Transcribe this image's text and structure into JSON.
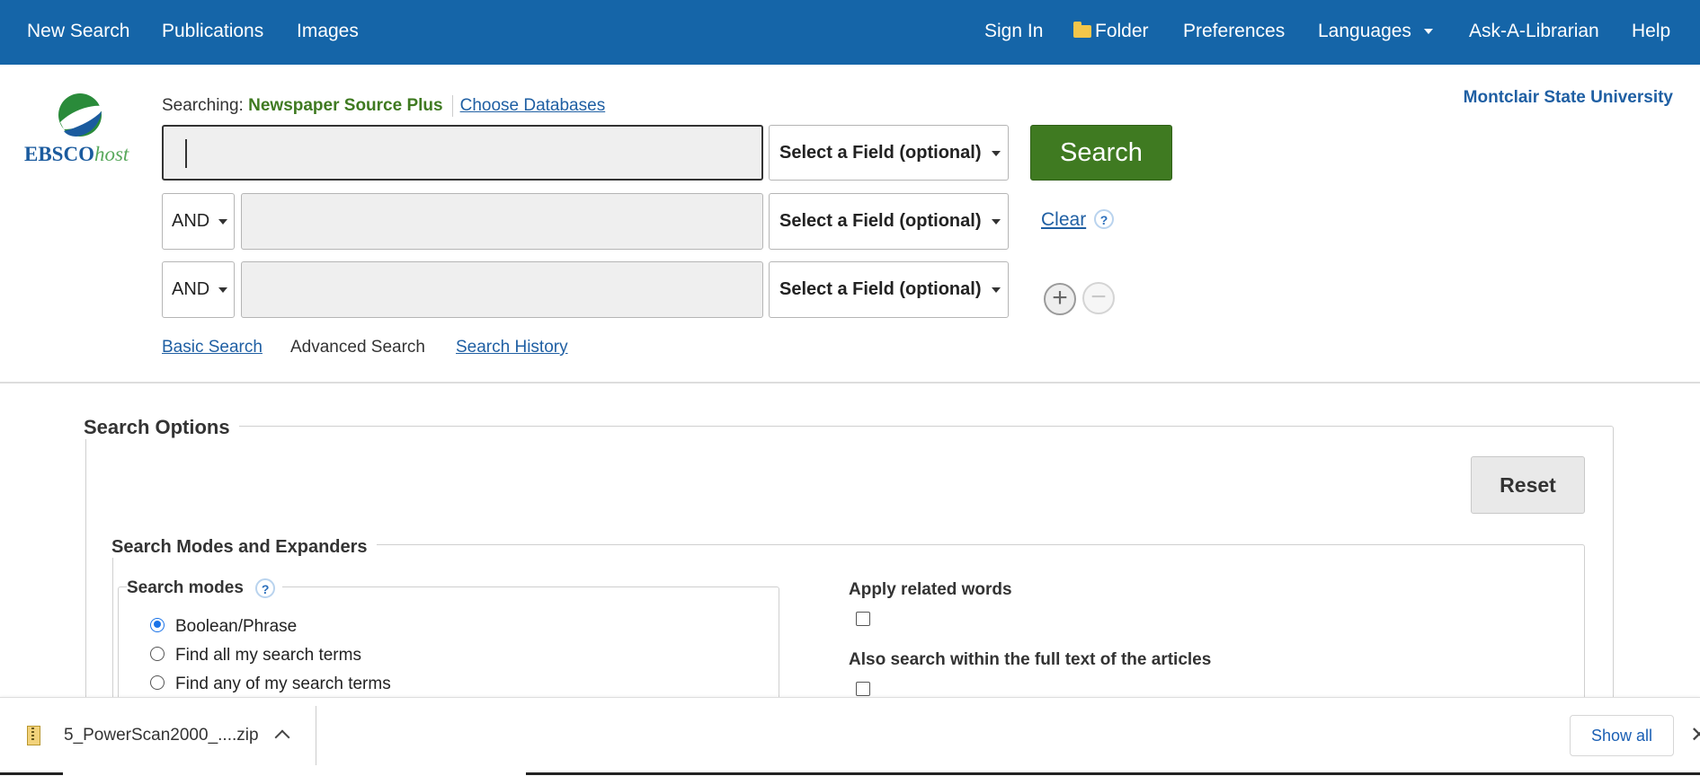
{
  "nav": {
    "left": [
      "New Search",
      "Publications",
      "Images"
    ],
    "sign_in": "Sign In",
    "folder": "Folder",
    "preferences": "Preferences",
    "languages": "Languages",
    "ask": "Ask-A-Librarian",
    "help": "Help"
  },
  "logo": {
    "text_main": "EBSCO",
    "text_host": "host"
  },
  "searching": {
    "label": "Searching:",
    "database": "Newspaper Source Plus",
    "choose_link": "Choose Databases"
  },
  "institution": "Montclair State University",
  "search_rows": [
    {
      "value": "",
      "field": "Select a Field (optional)"
    },
    {
      "operator": "AND",
      "value": "",
      "field": "Select a Field (optional)"
    },
    {
      "operator": "AND",
      "value": "",
      "field": "Select a Field (optional)"
    }
  ],
  "buttons": {
    "search": "Search",
    "clear": "Clear",
    "help": "?",
    "add": "+",
    "remove": "−"
  },
  "search_links": {
    "basic": "Basic Search",
    "advanced": "Advanced Search",
    "history": "Search History"
  },
  "options": {
    "title": "Search Options",
    "reset": "Reset",
    "modes_expanders": "Search Modes and Expanders",
    "search_modes": {
      "title": "Search modes",
      "items": [
        {
          "label": "Boolean/Phrase",
          "checked": true
        },
        {
          "label": "Find all my search terms",
          "checked": false
        },
        {
          "label": "Find any of my search terms",
          "checked": false
        }
      ]
    },
    "expanders": [
      {
        "label": "Apply related words",
        "checked": false
      },
      {
        "label": "Also search within the full text of the articles",
        "checked": false
      }
    ]
  },
  "download_bar": {
    "file": "5_PowerScan2000_....zip",
    "show_all": "Show all",
    "close": "✕"
  },
  "colors": {
    "nav_bg": "#1565a8",
    "search_green": "#3f7a21",
    "link_blue": "#1f5fa3"
  }
}
